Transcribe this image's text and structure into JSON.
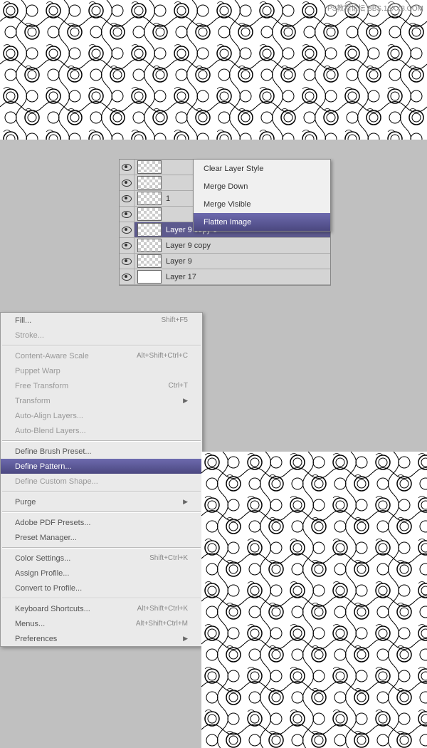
{
  "watermark": "PS教程论坛\nBBS.16XX8.COM",
  "contextMenu": {
    "items": [
      {
        "label": "Clear Layer Style",
        "hover": false
      },
      {
        "label": "Merge Down",
        "hover": false
      },
      {
        "label": "Merge Visible",
        "hover": false
      },
      {
        "label": "Flatten Image",
        "hover": true
      }
    ]
  },
  "layers": [
    {
      "name": "",
      "thumb": "checker",
      "selected": false
    },
    {
      "name": "",
      "thumb": "checker",
      "selected": false
    },
    {
      "name": "1",
      "thumb": "checker",
      "selected": false
    },
    {
      "name": "",
      "thumb": "checker",
      "selected": false
    },
    {
      "name": "Layer 9 copy 6",
      "thumb": "checker",
      "selected": true
    },
    {
      "name": "Layer 9 copy",
      "thumb": "checker",
      "selected": false
    },
    {
      "name": "Layer 9",
      "thumb": "checker",
      "selected": false
    },
    {
      "name": "Layer 17",
      "thumb": "white",
      "selected": false
    }
  ],
  "editMenu": {
    "groups": [
      [
        {
          "label": "Fill...",
          "shortcut": "Shift+F5",
          "disabled": false,
          "arrow": false
        },
        {
          "label": "Stroke...",
          "shortcut": "",
          "disabled": true,
          "arrow": false
        }
      ],
      [
        {
          "label": "Content-Aware Scale",
          "shortcut": "Alt+Shift+Ctrl+C",
          "disabled": true,
          "arrow": false
        },
        {
          "label": "Puppet Warp",
          "shortcut": "",
          "disabled": true,
          "arrow": false
        },
        {
          "label": "Free Transform",
          "shortcut": "Ctrl+T",
          "disabled": true,
          "arrow": false
        },
        {
          "label": "Transform",
          "shortcut": "",
          "disabled": true,
          "arrow": true
        },
        {
          "label": "Auto-Align Layers...",
          "shortcut": "",
          "disabled": true,
          "arrow": false
        },
        {
          "label": "Auto-Blend Layers...",
          "shortcut": "",
          "disabled": true,
          "arrow": false
        }
      ],
      [
        {
          "label": "Define Brush Preset...",
          "shortcut": "",
          "disabled": false,
          "arrow": false
        },
        {
          "label": "Define Pattern...",
          "shortcut": "",
          "disabled": false,
          "arrow": false,
          "hover": true
        },
        {
          "label": "Define Custom Shape...",
          "shortcut": "",
          "disabled": true,
          "arrow": false
        }
      ],
      [
        {
          "label": "Purge",
          "shortcut": "",
          "disabled": false,
          "arrow": true
        }
      ],
      [
        {
          "label": "Adobe PDF Presets...",
          "shortcut": "",
          "disabled": false,
          "arrow": false
        },
        {
          "label": "Preset Manager...",
          "shortcut": "",
          "disabled": false,
          "arrow": false
        }
      ],
      [
        {
          "label": "Color Settings...",
          "shortcut": "Shift+Ctrl+K",
          "disabled": false,
          "arrow": false
        },
        {
          "label": "Assign Profile...",
          "shortcut": "",
          "disabled": false,
          "arrow": false
        },
        {
          "label": "Convert to Profile...",
          "shortcut": "",
          "disabled": false,
          "arrow": false
        }
      ],
      [
        {
          "label": "Keyboard Shortcuts...",
          "shortcut": "Alt+Shift+Ctrl+K",
          "disabled": false,
          "arrow": false
        },
        {
          "label": "Menus...",
          "shortcut": "Alt+Shift+Ctrl+M",
          "disabled": false,
          "arrow": false
        },
        {
          "label": "Preferences",
          "shortcut": "",
          "disabled": false,
          "arrow": true
        }
      ]
    ]
  }
}
